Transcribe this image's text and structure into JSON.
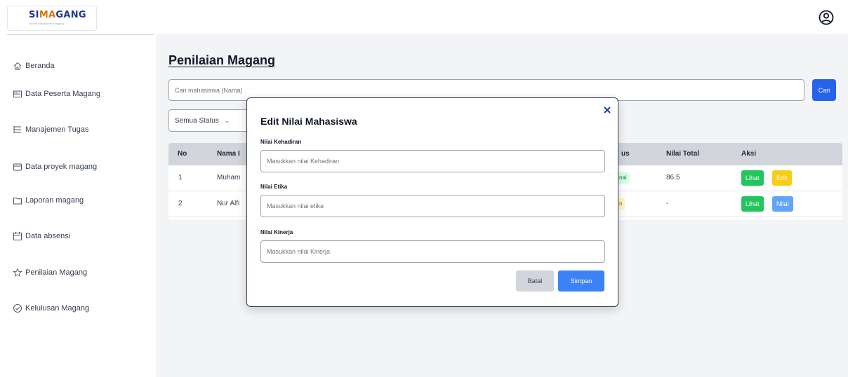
{
  "app": {
    "logo_text_pre": "SI",
    "logo_text_hl": "MA",
    "logo_text_post": "GANG",
    "logo_subtitle": "Sistem Manajemen Magang"
  },
  "sidebar": {
    "items": [
      {
        "label": "Beranda",
        "icon": "home-icon"
      },
      {
        "label": "Data Peserta Magang",
        "icon": "id-card-icon"
      },
      {
        "label": "Manajemen Tugas",
        "icon": "list-icon"
      },
      {
        "label": "Data proyek magang",
        "icon": "folder-icon"
      },
      {
        "label": "Laporan magang",
        "icon": "folder-open-icon"
      },
      {
        "label": "Data absensi",
        "icon": "calendar-icon"
      },
      {
        "label": "Penilaian Magang",
        "icon": "star-icon"
      },
      {
        "label": "Kelulusan Magang",
        "icon": "check-circle-icon"
      }
    ]
  },
  "header": {
    "profile_icon": "user-circle-icon"
  },
  "page": {
    "title": "Penilaian Magang",
    "search_placeholder": "Cari mahasiswa (Nama)",
    "search_button": "Cari",
    "status_filter": "Semua Status"
  },
  "table": {
    "headers": [
      "No",
      "Nama I",
      "us",
      "Nilai Total",
      "Aksi"
    ],
    "rows": [
      {
        "no": "1",
        "name": "Muham",
        "status": "nal",
        "total": "86.5",
        "btn1": "Lihat",
        "btn2": "Edit"
      },
      {
        "no": "2",
        "name": "Nur Alfi",
        "status": "n",
        "total": "-",
        "btn1": "Lihat",
        "btn2": "Nilai"
      }
    ]
  },
  "modal": {
    "title": "Edit Nilai Mahasiswa",
    "fields": [
      {
        "label": "Nilai Kehadiran",
        "placeholder": "Masukkan nilai Kehadiran"
      },
      {
        "label": "Nilai Etika",
        "placeholder": "Masukkan nilai etika"
      },
      {
        "label": "Nilai Kinerja",
        "placeholder": "Masukkan nilai Kinerja"
      }
    ],
    "cancel_label": "Batal",
    "save_label": "Simpan"
  },
  "colors": {
    "primary": "#2563eb",
    "save": "#3b82f6",
    "view": "#22c55e",
    "edit": "#facc15",
    "nilai": "#60a5fa"
  }
}
